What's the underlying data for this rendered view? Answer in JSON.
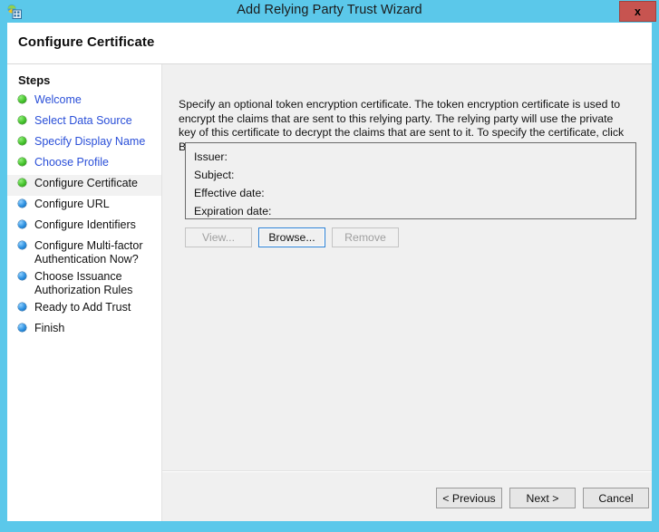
{
  "window": {
    "title": "Add Relying Party Trust Wizard",
    "icon": "adfs-wizard-icon",
    "close_label": "x",
    "titlebar_color": "#5bc8ea",
    "close_color": "#c75450"
  },
  "header": {
    "page_title": "Configure Certificate"
  },
  "sidebar": {
    "heading": "Steps",
    "items": [
      {
        "label": "Welcome",
        "state": "done",
        "bullet": "green"
      },
      {
        "label": "Select Data Source",
        "state": "done",
        "bullet": "green"
      },
      {
        "label": "Specify Display Name",
        "state": "done",
        "bullet": "green"
      },
      {
        "label": "Choose Profile",
        "state": "done",
        "bullet": "green"
      },
      {
        "label": "Configure Certificate",
        "state": "current",
        "bullet": "green"
      },
      {
        "label": "Configure URL",
        "state": "pending",
        "bullet": "blue"
      },
      {
        "label": "Configure Identifiers",
        "state": "pending",
        "bullet": "blue"
      },
      {
        "label": "Configure Multi-factor\nAuthentication Now?",
        "state": "pending",
        "bullet": "blue"
      },
      {
        "label": "Choose Issuance\nAuthorization Rules",
        "state": "pending",
        "bullet": "blue"
      },
      {
        "label": "Ready to Add Trust",
        "state": "pending",
        "bullet": "blue"
      },
      {
        "label": "Finish",
        "state": "pending",
        "bullet": "blue"
      }
    ]
  },
  "main": {
    "intro": "Specify an optional token encryption certificate.  The token encryption certificate is used to encrypt the claims that are sent to this relying party.  The relying party will use the private key of this certificate to decrypt the claims that are sent to it.  To specify the certificate, click Browse..",
    "certificate": {
      "issuer_label": "Issuer:",
      "issuer_value": "",
      "subject_label": "Subject:",
      "subject_value": "",
      "effective_date_label": "Effective date:",
      "effective_date_value": "",
      "expiration_date_label": "Expiration date:",
      "expiration_date_value": ""
    },
    "buttons": {
      "view": "View...",
      "browse": "Browse...",
      "remove": "Remove"
    }
  },
  "footer": {
    "previous": "< Previous",
    "next": "Next >",
    "cancel": "Cancel"
  }
}
